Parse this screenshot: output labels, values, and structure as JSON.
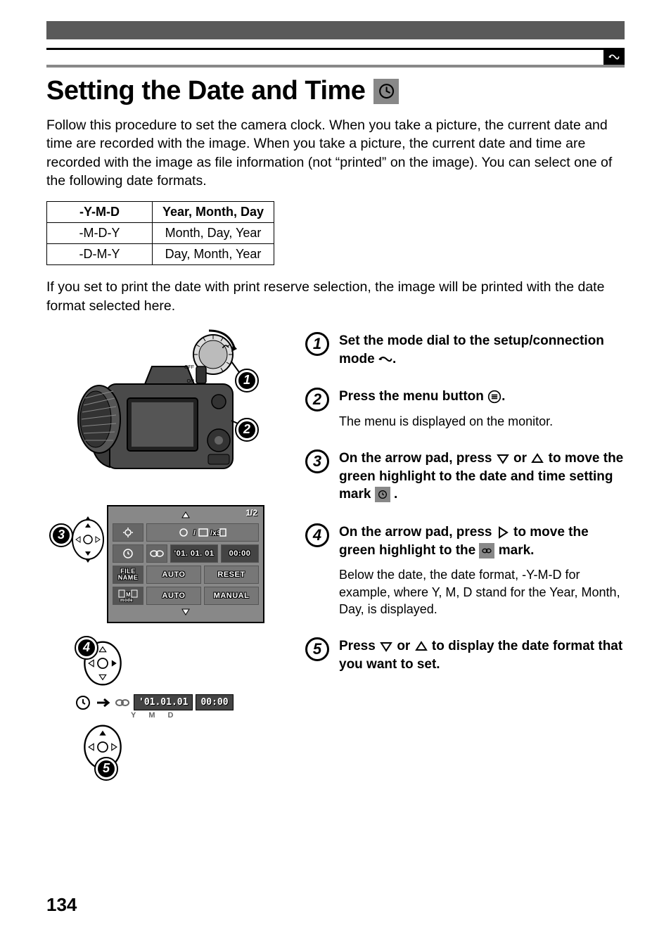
{
  "page_number": "134",
  "title": "Setting the Date and Time",
  "intro": "Follow this procedure to set the camera clock. When you take a picture, the current date and time are recorded with the image. When you take a picture, the current date and time are recorded with the image as file information (not “printed” on the image). You can select one of the following date formats.",
  "formats": [
    {
      "code": "-Y-M-D",
      "desc": "Year, Month, Day"
    },
    {
      "code": "-M-D-Y",
      "desc": "Month, Day, Year"
    },
    {
      "code": "-D-M-Y",
      "desc": "Day, Month, Year"
    }
  ],
  "note": "If you set to print the date with print reserve selection, the image will be printed with the date format selected here.",
  "steps": {
    "s1": {
      "title_a": "Set the mode dial to the setup/connection mode ",
      "title_b": "."
    },
    "s2": {
      "title_a": "Press the menu button ",
      "title_b": ".",
      "sub": "The menu is displayed on the monitor."
    },
    "s3": {
      "title_a": "On the arrow pad, press ",
      "title_b": " or ",
      "title_c": " to move the green highlight to the date and time setting mark ",
      "title_d": " ."
    },
    "s4": {
      "title_a": "On the arrow pad, press ",
      "title_b": " to move the green highlight to the ",
      "title_c": " mark.",
      "sub": "Below the date, the date format, -Y-M-D for example, where Y, M, D stand for the Year, Month, Day, is displayed."
    },
    "s5": {
      "title_a": "Press ",
      "title_b": " or ",
      "title_c": " to display the date format that you want to set."
    }
  },
  "menu": {
    "page": "1/2",
    "date": "'01. 01. 01",
    "time": "00:00",
    "file_name": "FILE NAME",
    "auto": "AUTO",
    "reset": "RESET",
    "mode": "mode",
    "manual": "MANUAL"
  },
  "date_display": {
    "date": "'01.01.01",
    "time": "00:00",
    "y": "Y",
    "m": "M",
    "d": "D"
  },
  "camera_labels": {
    "off": "OFF",
    "on": "ON"
  }
}
